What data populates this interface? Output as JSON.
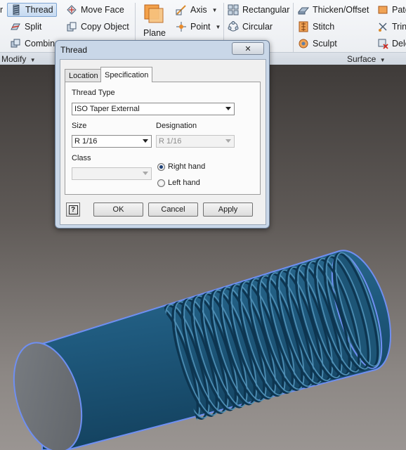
{
  "ribbon": {
    "col1": {
      "clipped_prefix": "r",
      "thread": "Thread",
      "split": "Split",
      "combine": "Combin"
    },
    "col2": {
      "move_face": "Move Face",
      "copy_object": "Copy Object"
    },
    "plane": "Plane",
    "col3": {
      "axis": "Axis",
      "point": "Point"
    },
    "col4": {
      "rectangular": "Rectangular",
      "circular": "Circular"
    },
    "col5": {
      "thicken_offset": "Thicken/Offset",
      "stitch": "Stitch",
      "sculpt": "Sculpt"
    },
    "col6": {
      "patch": "Pate",
      "trim": "Trin",
      "delete": "Dele"
    },
    "groups": {
      "modify": "Modify",
      "surface": "Surface"
    }
  },
  "dialog": {
    "title": "Thread",
    "close_glyph": "✕",
    "tabs": [
      "Location",
      "Specification"
    ],
    "selected_tab": "Specification",
    "thread_type_label": "Thread Type",
    "thread_type_value": "ISO Taper External",
    "size_label": "Size",
    "size_value": "R 1/16",
    "designation_label": "Designation",
    "designation_value": "R 1/16",
    "class_label": "Class",
    "class_value": "",
    "right_hand": "Right hand",
    "left_hand": "Left hand",
    "selected_hand": "right",
    "help_glyph": "?",
    "ok": "OK",
    "cancel": "Cancel",
    "apply": "Apply"
  },
  "colors": {
    "model_blue": "#1f5a7e",
    "highlight_edge": "#6f8ff2",
    "end_face": "#6d7175"
  }
}
